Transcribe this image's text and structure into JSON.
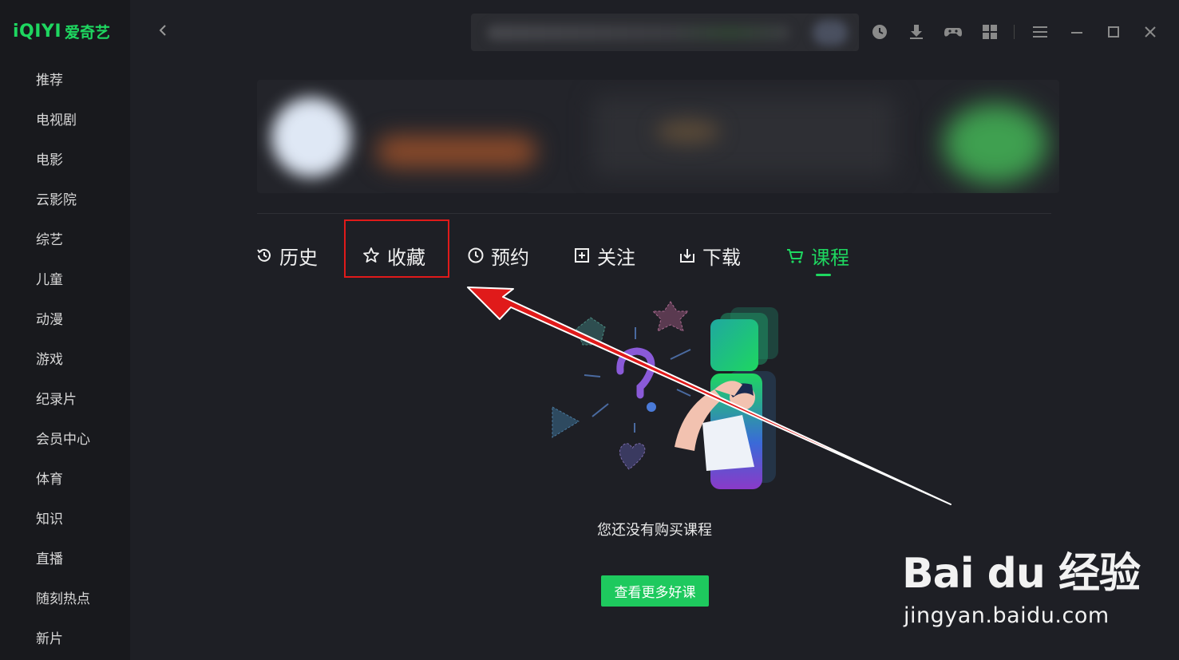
{
  "app": {
    "logo_text": "iQIYI",
    "logo_cn": "爱奇艺",
    "brand_color": "#1ed760"
  },
  "sidebar": {
    "items": [
      {
        "label": "推荐"
      },
      {
        "label": "电视剧"
      },
      {
        "label": "电影"
      },
      {
        "label": "云影院"
      },
      {
        "label": "综艺"
      },
      {
        "label": "儿童"
      },
      {
        "label": "动漫"
      },
      {
        "label": "游戏"
      },
      {
        "label": "纪录片"
      },
      {
        "label": "会员中心"
      },
      {
        "label": "体育"
      },
      {
        "label": "知识"
      },
      {
        "label": "直播"
      },
      {
        "label": "随刻热点"
      },
      {
        "label": "新片"
      }
    ]
  },
  "topbar": {
    "icons": [
      "history-icon",
      "download-icon",
      "gamepad-icon",
      "apps-grid-icon",
      "menu-icon",
      "minimize-icon",
      "maximize-icon",
      "close-icon"
    ]
  },
  "tabs": [
    {
      "label": "历史",
      "icon": "history-icon"
    },
    {
      "label": "收藏",
      "icon": "star-icon"
    },
    {
      "label": "预约",
      "icon": "clock-icon"
    },
    {
      "label": "关注",
      "icon": "follow-icon"
    },
    {
      "label": "下载",
      "icon": "download-icon"
    },
    {
      "label": "课程",
      "icon": "cart-icon",
      "active": true
    }
  ],
  "empty_state": {
    "message": "您还没有购买课程",
    "button_label": "查看更多好课"
  },
  "watermark": {
    "main": "Bai du 经验",
    "url": "jingyan.baidu.com"
  },
  "annotation": {
    "highlight_color": "#e01a1a"
  }
}
